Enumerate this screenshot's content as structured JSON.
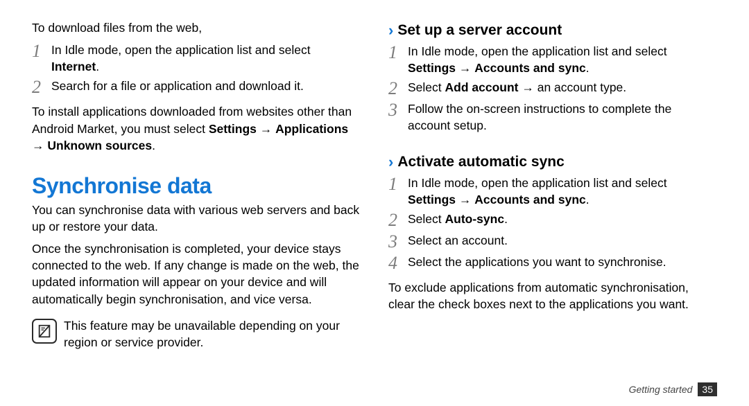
{
  "left": {
    "intro": "To download files from the web,",
    "steps1": [
      {
        "n": "1",
        "pre": "In Idle mode, open the application list and select ",
        "bold": "Internet",
        "post": "."
      },
      {
        "n": "2",
        "pre": "Search for a file or application and download it.",
        "bold": "",
        "post": ""
      }
    ],
    "install_p1": "To install applications downloaded from websites other than Android Market, you must select ",
    "install_b1": "Settings",
    "install_ar1": " → ",
    "install_b2": "Applications",
    "install_ar2": " → ",
    "install_b3": "Unknown sources",
    "install_end": ".",
    "h1": "Synchronise data",
    "sync_p1": "You can synchronise data with various web servers and back up or restore your data.",
    "sync_p2": "Once the synchronisation is completed, your device stays connected to the web. If any change is made on the web, the updated information will appear on your device and will automatically begin synchronisation, and vice versa.",
    "note": "This feature may be unavailable depending on your region or service provider."
  },
  "right": {
    "h2a": "Set up a server account",
    "stepsA": [
      {
        "n": "1",
        "pre": "In Idle mode, open the application list and select ",
        "bold": "Settings",
        "ar": " → ",
        "bold2": "Accounts and sync",
        "post": "."
      },
      {
        "n": "2",
        "pre": "Select ",
        "bold": "Add account",
        "ar": " → ",
        "bold2": "",
        "post": "an account type."
      },
      {
        "n": "3",
        "pre": "Follow the on-screen instructions to complete the account setup.",
        "bold": "",
        "ar": "",
        "bold2": "",
        "post": ""
      }
    ],
    "h2b": "Activate automatic sync",
    "stepsB": [
      {
        "n": "1",
        "pre": "In Idle mode, open the application list and select ",
        "bold": "Settings",
        "ar": " → ",
        "bold2": "Accounts and sync",
        "post": "."
      },
      {
        "n": "2",
        "pre": "Select ",
        "bold": "Auto-sync",
        "ar": "",
        "bold2": "",
        "post": "."
      },
      {
        "n": "3",
        "pre": "Select an account.",
        "bold": "",
        "ar": "",
        "bold2": "",
        "post": ""
      },
      {
        "n": "4",
        "pre": "Select the applications you want to synchronise.",
        "bold": "",
        "ar": "",
        "bold2": "",
        "post": ""
      }
    ],
    "exclude": "To exclude applications from automatic synchronisation, clear the check boxes next to the applications you want."
  },
  "footer": {
    "label": "Getting started",
    "page": "35"
  },
  "chevron": "›"
}
